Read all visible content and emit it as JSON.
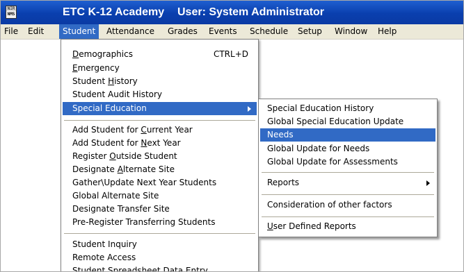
{
  "window": {
    "app_title": "ETC K-12 Academy",
    "user_label": "User: System Administrator"
  },
  "logo": {
    "line1": "NIR",
    "line2": "NMS"
  },
  "menubar": {
    "items": [
      "File",
      "Edit",
      "Student",
      "Attendance",
      "Grades",
      "Events",
      "Schedule",
      "Setup",
      "Window",
      "Help"
    ],
    "active": "Student"
  },
  "student_menu": {
    "demographics": {
      "pre": "",
      "u": "D",
      "post": "emographics",
      "shortcut": "CTRL+D"
    },
    "emergency": {
      "pre": "",
      "u": "E",
      "post": "mergency"
    },
    "student_history": {
      "pre": "Student ",
      "u": "H",
      "post": "istory"
    },
    "student_audit_history": "Student Audit History",
    "special_education": "Special Education",
    "add_current": {
      "pre": "Add Student for ",
      "u": "C",
      "post": "urrent Year"
    },
    "add_next": {
      "pre": "Add Student for ",
      "u": "N",
      "post": "ext Year"
    },
    "register_outside": {
      "pre": "Register ",
      "u": "O",
      "post": "utside Student"
    },
    "designate_alternate": {
      "pre": "Designate ",
      "u": "A",
      "post": "lternate Site"
    },
    "gather_update": "Gather\\Update Next Year Students",
    "global_alternate": "Global Alternate Site",
    "designate_transfer": "Designate Transfer Site",
    "pre_register": "Pre-Register Transferring Students",
    "student_inquiry": "Student Inquiry",
    "remote_access": "Remote Access",
    "spreadsheet": "Student Spreadsheet Data Entry"
  },
  "special_ed_submenu": {
    "history": "Special Education History",
    "global_update": "Global Special Education Update",
    "needs": "Needs",
    "global_update_needs": "Global Update for Needs",
    "global_update_assessments": "Global Update for  Assessments",
    "reports": "Reports",
    "consideration": "Consideration of other factors",
    "user_defined": {
      "pre": "",
      "u": "U",
      "post": "ser Defined Reports"
    }
  },
  "colors": {
    "titlebar": "#0a3fae",
    "highlight": "#316ac5",
    "menubar": "#ece9d8"
  }
}
